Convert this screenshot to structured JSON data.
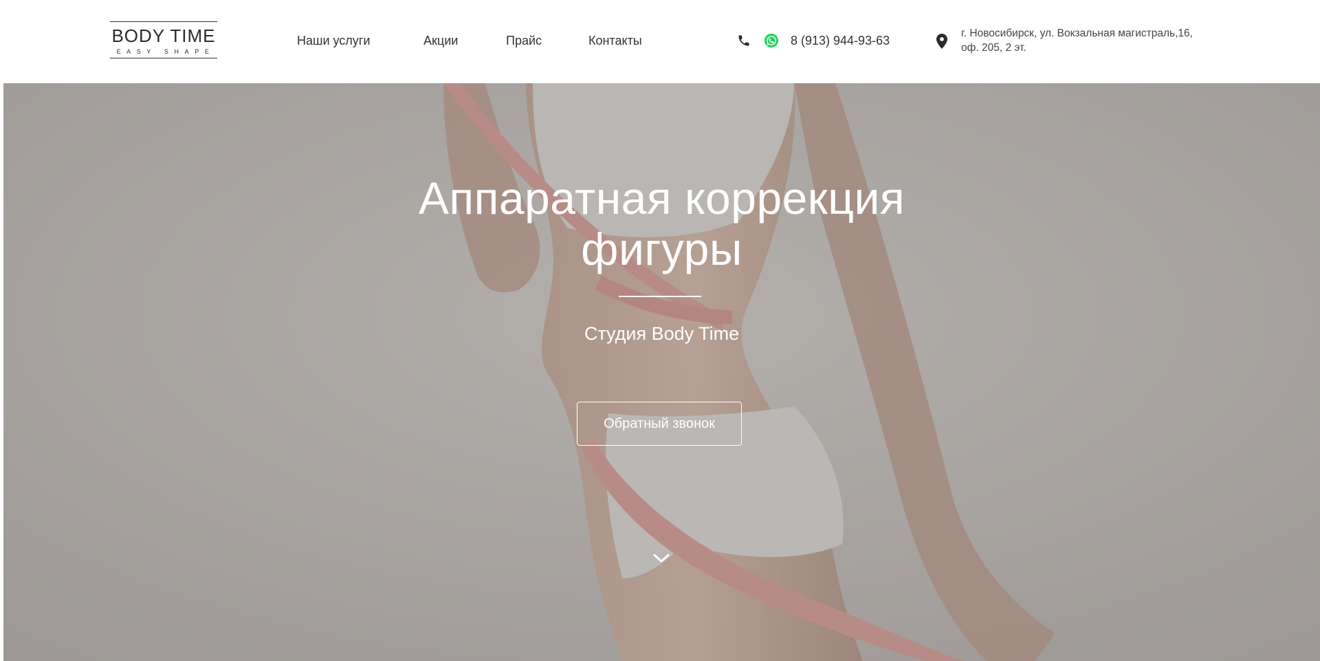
{
  "brand": {
    "name": "BODY TIME",
    "tagline": "EASY SHAPE"
  },
  "nav": {
    "items": [
      {
        "label": "Наши услуги"
      },
      {
        "label": "Акции"
      },
      {
        "label": "Прайс"
      },
      {
        "label": "Контакты"
      }
    ]
  },
  "contact": {
    "phone": "8 (913) 944-93-63",
    "address_line1": "г. Новосибирск, ул. Вокзальная магистраль,16,",
    "address_line2": "оф. 205, 2 эт.",
    "icons": [
      "phone-icon",
      "whatsapp-icon",
      "map-pin-icon"
    ]
  },
  "hero": {
    "title_line1": "Аппаратная коррекция",
    "title_line2": "фигуры",
    "subtitle": "Студия Body Time",
    "cta_label": "Обратный звонок",
    "scroll_icon": "chevron-down-icon"
  },
  "colors": {
    "header_bg": "#ffffff",
    "text_dark": "#333333",
    "hero_overlay": "#a7a29f",
    "hero_text": "#ffffff",
    "whatsapp_green": "#25d366"
  }
}
